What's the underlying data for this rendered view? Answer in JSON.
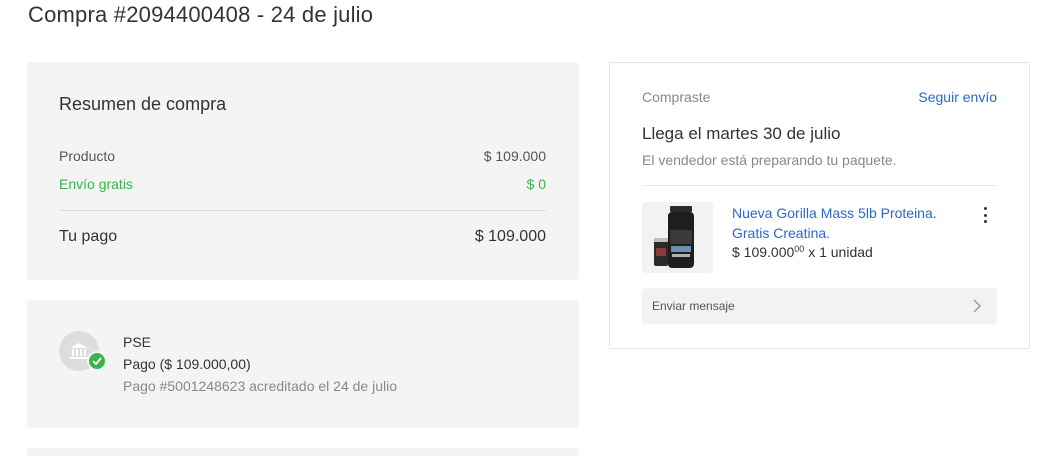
{
  "order": {
    "title": "Compra #2094400408 - 24 de julio"
  },
  "summary": {
    "title": "Resumen de compra",
    "product_label": "Producto",
    "product_value": "$ 109.000",
    "shipping_label": "Envío gratis",
    "shipping_value": "$ 0",
    "total_label": "Tu pago",
    "total_value": "$ 109.000",
    "shipping_color": "#39b54a"
  },
  "payment": {
    "method": "PSE",
    "amount": "Pago ($ 109.000,00)",
    "reference": "Pago #5001248623 acreditado el 24 de julio",
    "icon": "bank-icon",
    "status_icon": "check-icon"
  },
  "shipment": {
    "bought_label": "Compraste",
    "track_link": "Seguir envío",
    "arrival": "Llega el martes 30 de julio",
    "seller_status": "El vendedor está preparando tu paquete.",
    "product": {
      "name": "Nueva Gorilla Mass 5lb Proteina. Gratis Creatina.",
      "price_main": "$ 109.000",
      "price_cents": "00",
      "quantity": "x 1 unidad"
    },
    "message_button": "Enviar mensaje",
    "link_color": "#2968c8"
  }
}
